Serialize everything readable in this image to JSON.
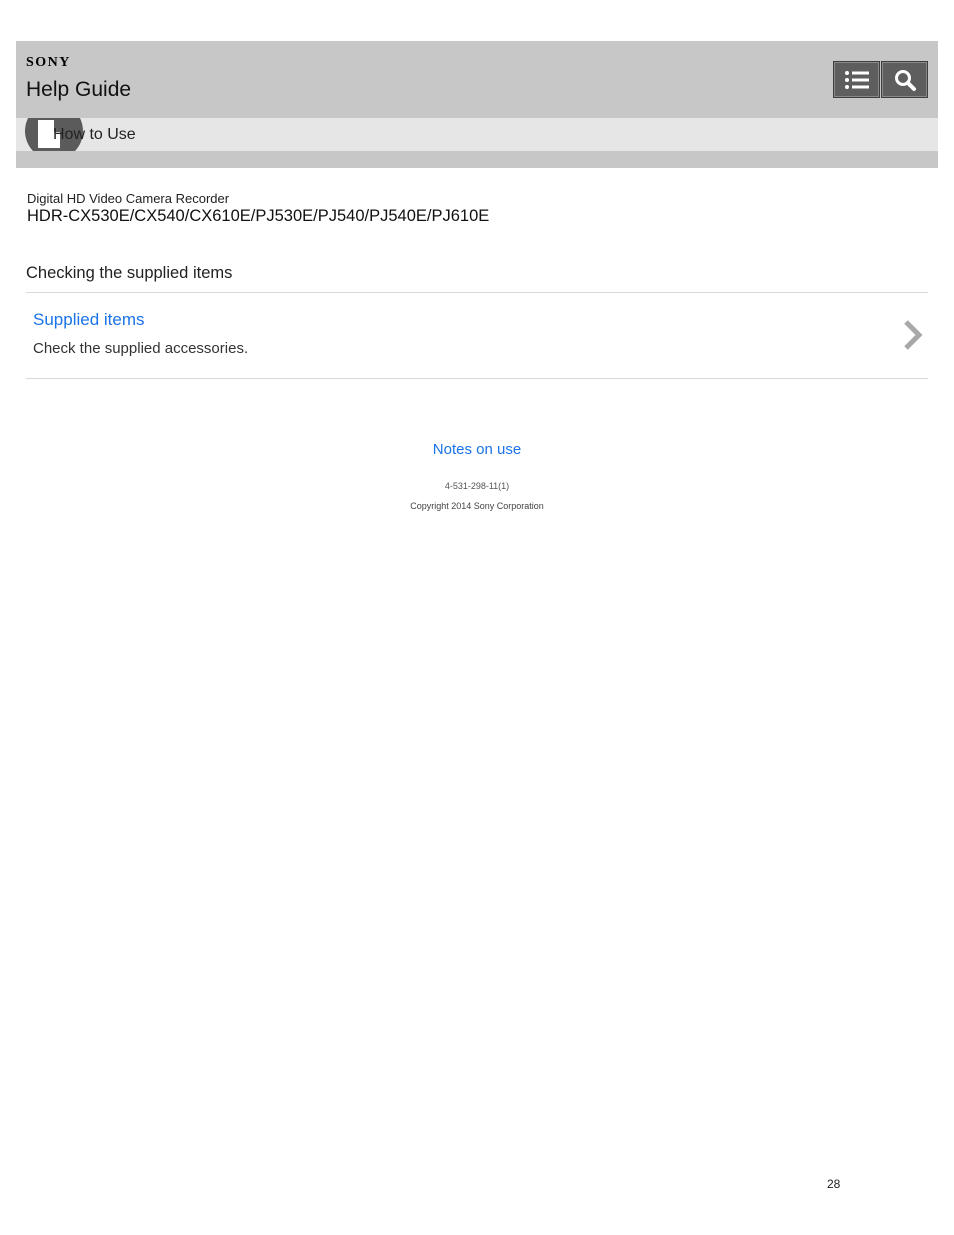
{
  "header": {
    "brand": "SONY",
    "title": "Help Guide",
    "toc_button_icon": "list-icon",
    "search_button_icon": "search-icon",
    "button_color": "#5e5e5e",
    "background_color": "#c7c7c7"
  },
  "breadcrumb": {
    "icon": "how-to-use-category-icon",
    "label": "How to Use"
  },
  "product": {
    "name": "Digital HD Video Camera Recorder",
    "models": "HDR-CX530E/CX540/CX610E/PJ530E/PJ540/PJ540E/PJ610E"
  },
  "section": {
    "title": "Checking the supplied items",
    "items": [
      {
        "title": "Supplied items",
        "description": "Check the supplied accessories.",
        "arrow_icon": "chevron-right-icon"
      }
    ]
  },
  "footer": {
    "notes_link": "Notes on use",
    "doc_code": "4-531-298-11(1)",
    "copyright": "Copyright 2014 Sony Corporation",
    "page_number": "28",
    "link_color": "#1a73e8"
  }
}
